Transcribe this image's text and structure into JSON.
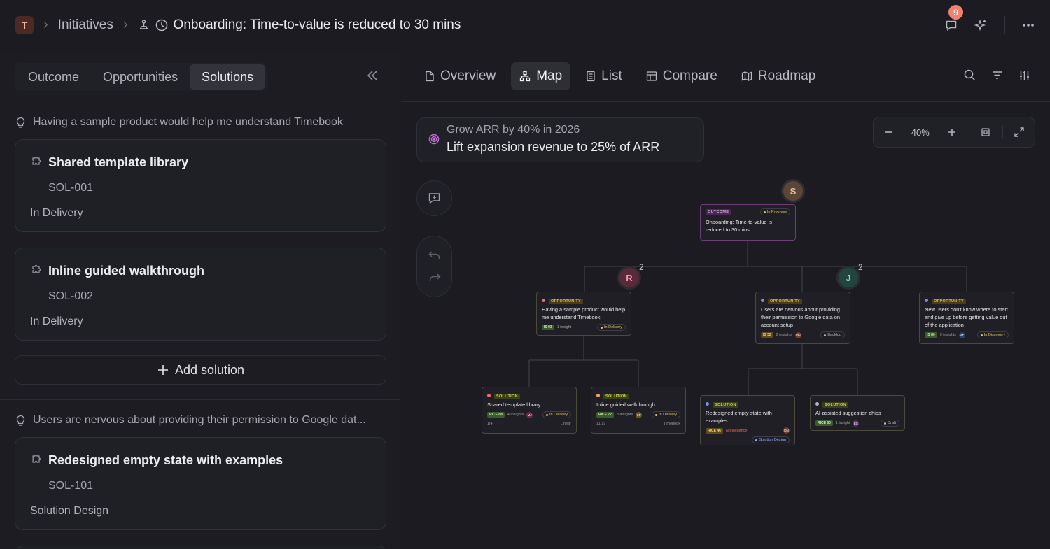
{
  "topbar": {
    "workspace_initial": "T",
    "breadcrumb_initiatives": "Initiatives",
    "page_title": "Onboarding: Time-to-value is reduced to 30 mins",
    "notification_count": "9"
  },
  "left": {
    "tabs": [
      "Outcome",
      "Opportunities",
      "Solutions"
    ],
    "active_tab": "Solutions",
    "groups": [
      {
        "heading": "Having a sample product would help me understand Timebook",
        "cards": [
          {
            "title": "Shared template library",
            "id": "SOL-001",
            "status": "In Delivery"
          },
          {
            "title": "Inline guided walkthrough",
            "id": "SOL-002",
            "status": "In Delivery"
          }
        ]
      },
      {
        "heading": "Users are nervous about providing their permission to Google dat...",
        "cards": [
          {
            "title": "Redesigned empty state with examples",
            "id": "SOL-101",
            "status": "Solution Design"
          }
        ]
      }
    ],
    "add_solution_label": "Add solution"
  },
  "right": {
    "tabs": [
      "Overview",
      "Map",
      "List",
      "Compare",
      "Roadmap"
    ],
    "active_tab": "Map",
    "goal": {
      "line1": "Grow ARR by 40% in 2026",
      "line2": "Lift expansion revenue to 25% of ARR"
    },
    "zoom": "40%"
  },
  "map": {
    "outcome": {
      "tag": "OUTCOME",
      "status": "In Progress",
      "title": "Onboarding: Time-to-value is reduced to 30 mins",
      "avatar": "S"
    },
    "opportunities": [
      {
        "tag": "OPPORTUNITY",
        "title": "Having a sample product would help me understand Timebook",
        "score": "IS 93",
        "insights": "1 insight",
        "status": "In Delivery",
        "avatar": "R",
        "avatar_count": "2"
      },
      {
        "tag": "OPPORTUNITY",
        "title": "Users are nervous about providing their permission to Google data on account setup",
        "score": "IS 32",
        "insights": "2 insights",
        "owner": "DN",
        "status": "Backlog",
        "avatar": "J",
        "avatar_count": "2"
      },
      {
        "tag": "OPPORTUNITY",
        "title": "New users don't know where to start and give up before getting value out of the application",
        "score": "IS 80",
        "insights": "9 insights",
        "owner": "AT",
        "status": "In Discovery"
      }
    ],
    "solutions": [
      {
        "tag": "SOLUTION",
        "title": "Shared template library",
        "score": "RICE 68",
        "insights": "4 insights",
        "owner": "MJ",
        "status": "In Delivery",
        "progress": "1/4",
        "source": "Linear"
      },
      {
        "tag": "SOLUTION",
        "title": "Inline guided walkthrough",
        "score": "RICE 72",
        "insights": "3 insights",
        "owner": "KP",
        "status": "In Delivery",
        "progress": "11/19",
        "source": "Timebook"
      },
      {
        "tag": "SOLUTION",
        "title": "Redesigned empty state with examples",
        "score": "RICE 46",
        "insights": "No evidence",
        "owner": "DN",
        "status": "Solution Design"
      },
      {
        "tag": "SOLUTION",
        "title": "AI-assisted suggestion chips",
        "score": "RICE 60",
        "insights": "1 insight",
        "owner": "ES",
        "status": "Draft"
      }
    ]
  },
  "colors": {
    "accent": "#f0816f",
    "outcome": "#c56bd8",
    "opportunity": "#e0b64d",
    "solution": "#c9cf60"
  }
}
